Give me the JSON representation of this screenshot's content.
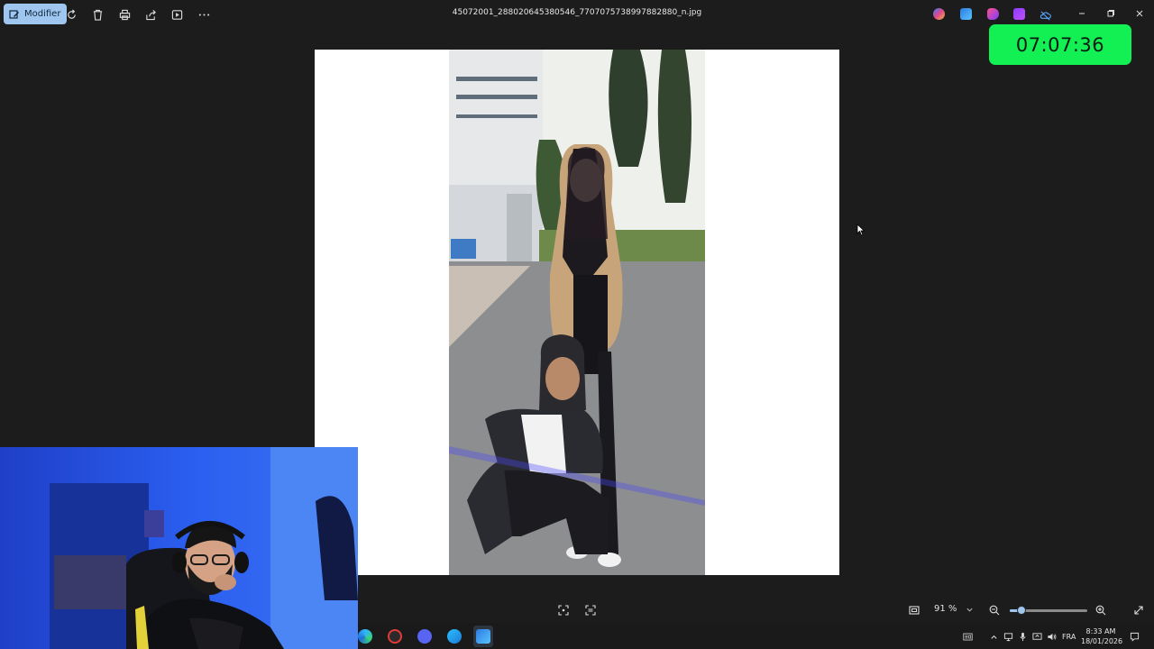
{
  "toolbar": {
    "edit_label": "Modifier",
    "filename": "45072001_288020645380546_7707075738997882880_n.jpg",
    "tools": [
      "rotate-icon",
      "trash-icon",
      "print-icon",
      "share-icon",
      "slideshow-icon",
      "more-icon"
    ]
  },
  "title_bar_apps": [
    "copilot-icon",
    "photos-editor-icon",
    "app-icon-pink",
    "clipchamp-icon",
    "onedrive-off-icon"
  ],
  "timer": {
    "value": "07:07:36",
    "color": "#12f053"
  },
  "bottom": {
    "zoom_value": "91 %",
    "zoom_level": 0.15
  },
  "taskbar": {
    "apps": [
      "edge-icon",
      "recorder-icon",
      "discord-icon",
      "browser-icon",
      "photos-icon"
    ],
    "language": "FRA",
    "time": "8:33 AM",
    "date": "18/01/2026"
  },
  "colors": {
    "accent": "#9fc6ee",
    "background": "#1c1c1c"
  }
}
